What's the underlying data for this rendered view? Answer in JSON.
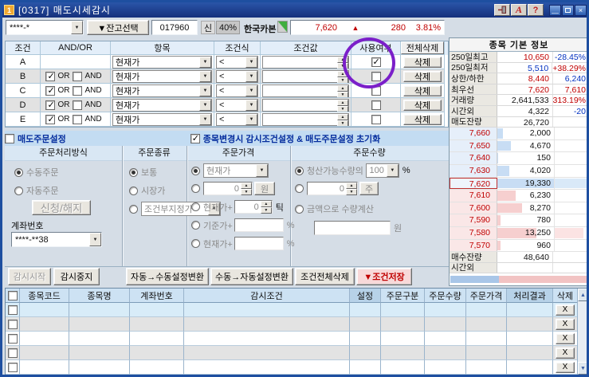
{
  "colors": {
    "titlebar_navy": "#15307c",
    "up_red": "#c00000",
    "down_blue": "#0030c0",
    "ask_bar_blue": "#c8ddf4",
    "bid_bar_pink": "#f6cfcf",
    "annotation_purple": "#7b1fc9",
    "save_button_pink": "#f8d9d9"
  },
  "window": {
    "icon_text": "1",
    "title": "[0317]  매도시세감시"
  },
  "titlebar": {
    "font_label": "A",
    "help_label": "?",
    "close_label": "×"
  },
  "toolbar": {
    "account_value": "****-*",
    "balance_select_label": "▼잔고선택",
    "stock_code": "017960",
    "credit_badge": "신",
    "margin_badge": "40%",
    "stock_name": "한국카본",
    "price": "7,620",
    "arrow": "▲",
    "change": "280",
    "change_pct": "3.81%"
  },
  "condition_table": {
    "headers": [
      "조건",
      "AND/OR",
      "항목",
      "조건식",
      "조건값",
      "사용여부",
      "전체삭제"
    ],
    "or_label": "OR",
    "and_label": "AND",
    "delete_label": "삭제",
    "rows": [
      {
        "id": "A",
        "item": "현재가",
        "op": "<",
        "value": "",
        "use": true
      },
      {
        "id": "B",
        "or": true,
        "and": false,
        "item": "현재가",
        "op": "<",
        "value": "",
        "use": false
      },
      {
        "id": "C",
        "or": true,
        "and": false,
        "item": "현재가",
        "op": "<",
        "value": "",
        "use": false
      },
      {
        "id": "D",
        "or": true,
        "and": false,
        "item": "현재가",
        "op": "<",
        "value": "",
        "use": false
      },
      {
        "id": "E",
        "or": true,
        "and": false,
        "item": "현재가",
        "op": "<",
        "value": "",
        "use": false
      }
    ]
  },
  "sell_settings_bar": {
    "sell_order_label": "매도주문설정",
    "sell_order_checked": false,
    "init_label": "종목변경시  감시조건설정  &  매도주문설정  초기화",
    "init_checked": true
  },
  "order_settings": {
    "col_headers": [
      "주문처리방식",
      "주문종류",
      "주문가격",
      "주문수량"
    ],
    "process": {
      "manual_label": "수동주문",
      "manual_selected": true,
      "auto_label": "자동주문",
      "auto_selected": false,
      "apply_button": "신청/해지",
      "account_label": "계좌번호",
      "account_value": "****-**38"
    },
    "order_type": {
      "normal_label": "보통",
      "normal_selected": true,
      "market_label": "시장가",
      "market_selected": false,
      "conditional_value": "조건부지정가",
      "conditional_selected": false
    },
    "order_price": {
      "current_value": "현재가",
      "current_selected": true,
      "won_value": "0",
      "won_unit": "원",
      "cur_tick_label": "현재가+",
      "tick_value": "0",
      "tick_unit": "틱",
      "base_label": "기준가+",
      "base_value": "",
      "base_unit": "%",
      "cur_pct_label": "현재가+",
      "cur_pct_value": "",
      "cur_pct_unit": "%"
    },
    "order_qty": {
      "liq_label": "청산가능수량의",
      "liq_selected": true,
      "liq_value": "100",
      "liq_unit": "%",
      "shares_value": "0",
      "shares_unit": "주",
      "amount_label": "금액으로  수량계산",
      "amount_selected": false,
      "amount_value": "",
      "amount_unit": "원"
    }
  },
  "action_buttons": {
    "start": "감시시작",
    "stop": "감시중지",
    "auto_to_manual": "자동→수동설정변환",
    "manual_to_auto": "수동→자동설정변환",
    "delete_all": "조건전체삭제",
    "save": "▼조건저장"
  },
  "watch_table": {
    "headers": [
      "종목코드",
      "종목명",
      "계좌번호",
      "감시조건",
      "설정",
      "주문구분",
      "주문수량",
      "주문가격",
      "처리결과",
      "삭제"
    ],
    "delete_label": "X",
    "row_count": 5
  },
  "info_panel": {
    "title": "종목 기본 정보",
    "rows": [
      {
        "label": "250일최고",
        "value": "10,650",
        "extra": "-28.45%"
      },
      {
        "label": "250일최저",
        "value": "5,510",
        "extra": "+38.29%"
      },
      {
        "label": "상한/하한",
        "value": "8,440",
        "extra": "6,240"
      },
      {
        "label": "최우선",
        "value": "7,620",
        "extra": "7,610"
      },
      {
        "label": "거래량",
        "value": "2,641,533",
        "extra": "313.19%"
      },
      {
        "label": "시간외",
        "value": "4,322",
        "extra": "-20"
      },
      {
        "label": "매도잔량",
        "value": "26,720",
        "extra": ""
      }
    ],
    "asks": [
      {
        "price": "7,660",
        "qty": "2,000",
        "bar": 10
      },
      {
        "price": "7,650",
        "qty": "4,670",
        "bar": 24
      },
      {
        "price": "7,640",
        "qty": "150",
        "bar": 2
      },
      {
        "price": "7,630",
        "qty": "4,020",
        "bar": 21
      },
      {
        "price": "7,620",
        "qty": "19,330",
        "bar": 100,
        "extra_bar": 100
      }
    ],
    "bids": [
      {
        "price": "7,610",
        "qty": "6,230",
        "bar": 32
      },
      {
        "price": "7,600",
        "qty": "8,270",
        "bar": 43
      },
      {
        "price": "7,590",
        "qty": "780",
        "bar": 5
      },
      {
        "price": "7,580",
        "qty": "13,250",
        "bar": 69,
        "extra_bar": 85
      },
      {
        "price": "7,570",
        "qty": "960",
        "bar": 6
      }
    ],
    "buy_total_label": "매수잔량",
    "buy_total_value": "48,640",
    "after_hours_label": "시간외",
    "after_hours_value": "",
    "ratio_sell_pct": 35.5
  }
}
